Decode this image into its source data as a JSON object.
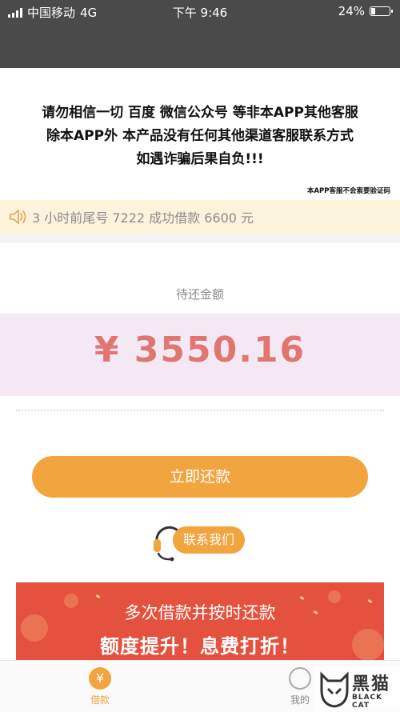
{
  "status_bar": {
    "carrier": "中国移动",
    "network": "4G",
    "time": "下午 9:46",
    "battery": "24%",
    "battery_level": 0.24
  },
  "warning": {
    "line1": "请勿相信一切 百度 微信公众号 等非本APP其他客服",
    "line2": "除本APP外 本产品没有任何其他渠道客服联系方式",
    "line3": "如遇诈骗后果自负!!!",
    "note": "本APP客服不会索要验证码"
  },
  "notice": {
    "text": "3 小时前尾号 7222 成功借款 6600 元"
  },
  "repayment": {
    "label": "待还金额",
    "amount": "¥ 3550.16"
  },
  "actions": {
    "repay_label": "立即还款",
    "contact_label": "联系我们"
  },
  "banner": {
    "line1": "多次借款并按时还款",
    "line2": "额度提升！息费打折！"
  },
  "tabbar": {
    "loan_icon": "¥",
    "loan_label": "借款",
    "mine_label": "我的"
  },
  "watermark": {
    "cn": "黑猫",
    "en": "BLACK CAT"
  },
  "colors": {
    "accent": "#f2a43e",
    "banner_red": "#e4513e",
    "amount": "#e06a63",
    "status_bg": "#4a4a4a"
  }
}
